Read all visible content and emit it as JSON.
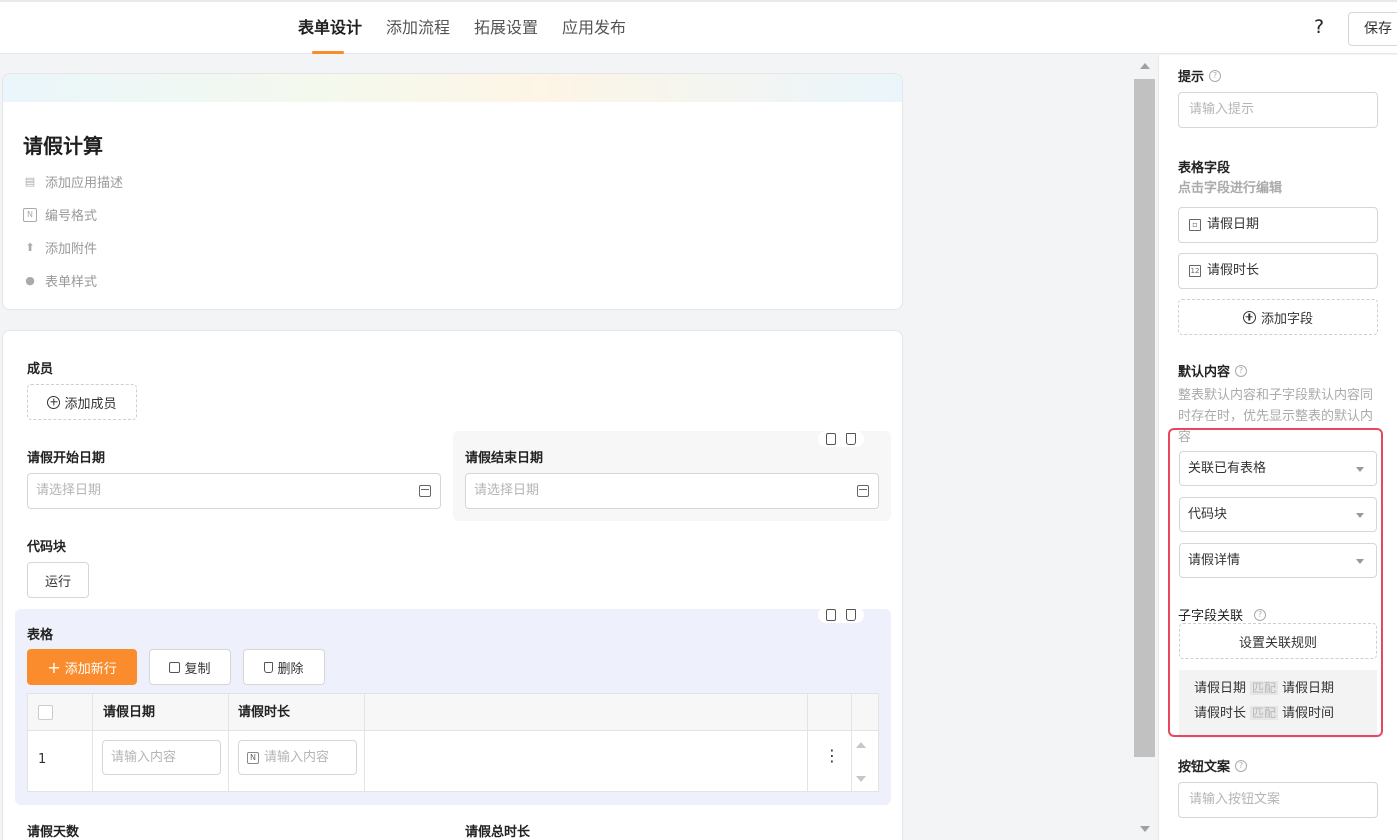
{
  "header": {
    "tabs": [
      "表单设计",
      "添加流程",
      "拓展设置",
      "应用发布"
    ],
    "help": "?",
    "save": "保存"
  },
  "form_card": {
    "title": "请假计算",
    "items": [
      "添加应用描述",
      "编号格式",
      "添加附件",
      "表单样式"
    ]
  },
  "fields": {
    "member_label": "成员",
    "add_member": "添加成员",
    "start_date_label": "请假开始日期",
    "start_date_placeholder": "请选择日期",
    "end_date_label": "请假结束日期",
    "end_date_placeholder": "请选择日期",
    "code_block_label": "代码块",
    "run_button": "运行",
    "table_label": "表格",
    "add_row": "添加新行",
    "copy": "复制",
    "delete": "删除",
    "columns": [
      "请假日期",
      "请假时长"
    ],
    "row_index": "1",
    "cell_placeholder": "请输入内容",
    "leave_days_label": "请假天数",
    "leave_total_label": "请假总时长"
  },
  "panel": {
    "hint_label": "提示",
    "hint_placeholder": "请输入提示",
    "table_fields_label": "表格字段",
    "table_fields_sub": "点击字段进行编辑",
    "field1": "请假日期",
    "field2": "请假时长",
    "add_field": "添加字段",
    "default_label": "默认内容",
    "default_desc_1": "整表默认内容和子字段默认内容同",
    "default_desc_2": "时存在时，优先显示整表的默认内",
    "default_desc_3": "容",
    "select1": "关联已有表格",
    "select2": "代码块",
    "select3": "请假详情",
    "sub_rel_label": "子字段关联",
    "set_rule": "设置关联规则",
    "rel1_left": "请假日期",
    "rel1_right": "请假日期",
    "rel2_left": "请假时长",
    "rel2_right": "请假时间",
    "match": "匹配",
    "btn_text_label": "按钮文案",
    "btn_text_placeholder": "请输入按钮文案"
  },
  "colors": {
    "accent": "#fa8c2d",
    "highlight": "#e8475f"
  }
}
